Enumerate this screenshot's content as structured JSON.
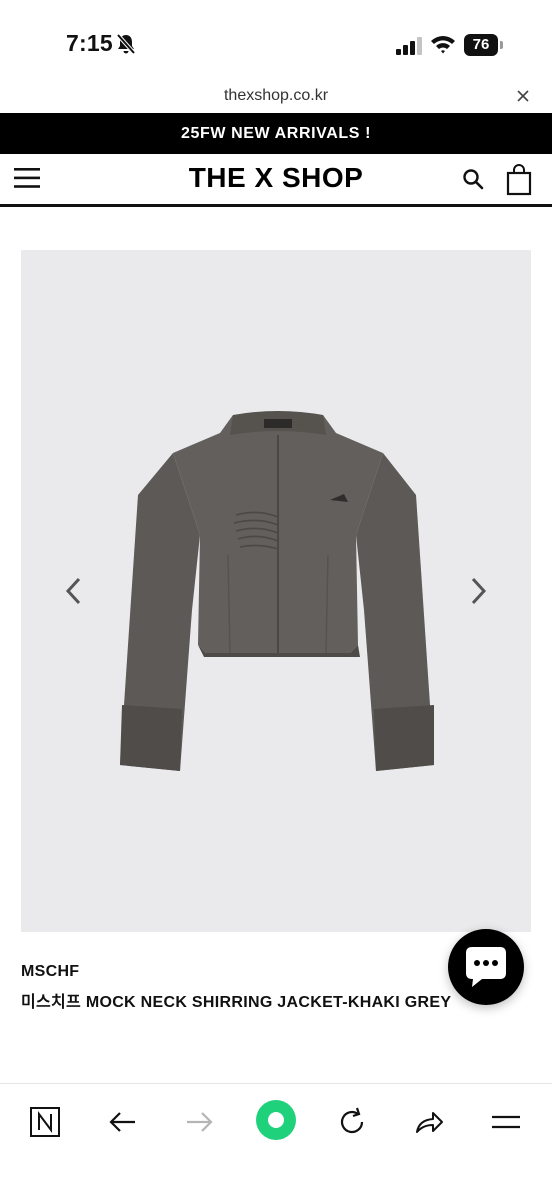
{
  "status_bar": {
    "time": "7:15",
    "battery": "76"
  },
  "browser": {
    "url": "thexshop.co.kr"
  },
  "banner": {
    "text": "25FW NEW ARRIVALS !"
  },
  "header": {
    "logo": "THE X SHOP"
  },
  "product": {
    "brand": "MSCHF",
    "name": "미스치프 MOCK NECK SHIRRING JACKET-KHAKI GREY",
    "label_tag": "MSCHF"
  },
  "colors": {
    "banner_bg": "#000000",
    "image_bg": "#eaeaec",
    "jacket": "#5b5855",
    "toolbar_accent": "#1fd17a"
  },
  "icons": {
    "status": [
      "bell-off-icon",
      "signal-icon",
      "wifi-icon",
      "battery-icon"
    ],
    "header": [
      "menu-icon",
      "search-icon",
      "shopping-bag-icon"
    ],
    "gallery": [
      "chevron-left-icon",
      "chevron-right-icon"
    ],
    "toolbar": [
      "naver-n-icon",
      "back-arrow-icon",
      "forward-arrow-icon",
      "green-home-icon",
      "reload-icon",
      "share-icon",
      "menu-lines-icon"
    ]
  }
}
